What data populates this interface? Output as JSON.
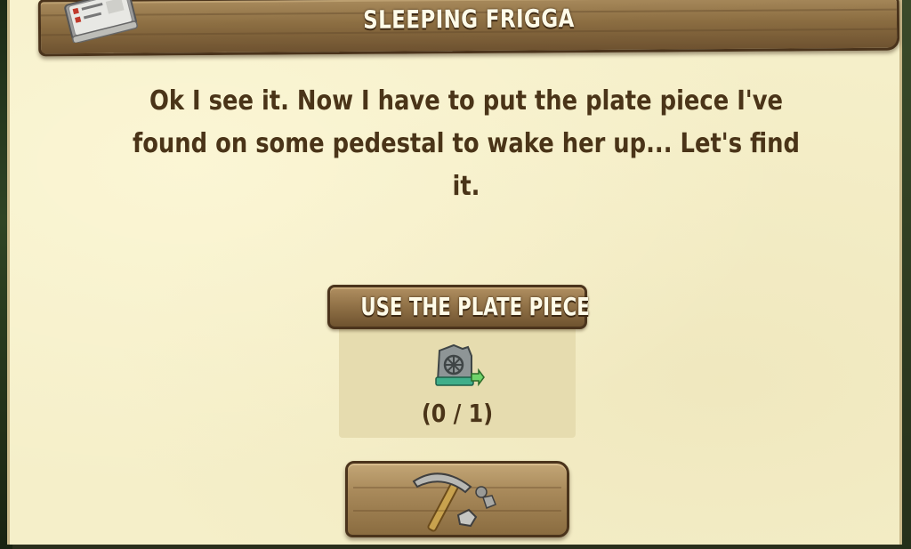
{
  "dialog": {
    "title": "SLEEPING FRIGGA",
    "message": "Ok I see it. Now I have to put the plate piece I've found on some pedestal to wake her up... Let's find it."
  },
  "task": {
    "label": "USE THE PLATE PIECE",
    "item_icon": "stone-plate-piece-icon",
    "progress_text": "(0 / 1)",
    "current": 0,
    "required": 1
  },
  "action": {
    "icon": "pickaxe-icon"
  },
  "colors": {
    "parchment": "#f5efc9",
    "wood": "#8c6e42",
    "text_brown": "#4a3418",
    "title_text": "#fffbe8"
  }
}
